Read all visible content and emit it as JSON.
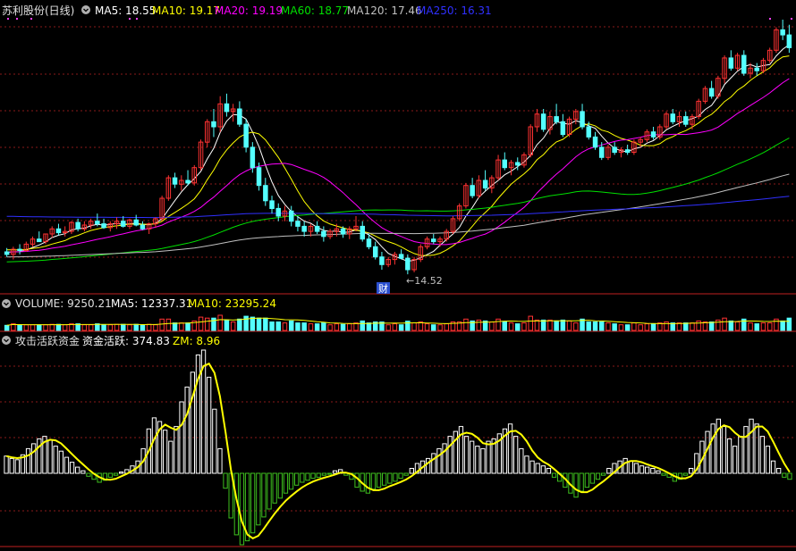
{
  "colors": {
    "background": "#000000",
    "up": "#ff3232",
    "down": "#54ffff",
    "grid": "#8a1a1a",
    "ma5": "#ffffff",
    "ma10": "#ffff00",
    "ma20": "#ff00ff",
    "ma60": "#00e000",
    "ma120": "#c0c0c0",
    "ma250": "#3030ff",
    "volume_ma10": "#ffff00",
    "flow_positive": "#ffffff",
    "flow_negative": "#3ec01e",
    "flow_line": "#ffff00"
  },
  "header": {
    "title": "苏利股份(日线)",
    "dropdown_icon": "circle-chevron-icon",
    "ma5": "MA5: 18.55",
    "ma10": "MA10: 19.17",
    "ma20": "MA20: 19.19",
    "ma60": "MA60: 18.77",
    "ma120": "MA120: 17.46",
    "ma250": "MA250: 16.31"
  },
  "volume_header": {
    "volume": "VOLUME: 9250.21",
    "ma5": "MA5: 12337.31",
    "ma10": "MA10: 23295.24"
  },
  "indicator_header": {
    "name": "攻击活跃资金",
    "active": "资金活跃: 374.83",
    "zm": "ZM: 8.96"
  },
  "annotations": {
    "low_label": "←14.52",
    "finance_badge": "财"
  },
  "chart_data": [
    {
      "type": "candlestick",
      "title": "苏利股份(日线)",
      "price_range": [
        14.0,
        24.5
      ],
      "series_visible_low": 14.52,
      "moving_averages": [
        {
          "name": "MA5",
          "last": 18.55
        },
        {
          "name": "MA10",
          "last": 19.17
        },
        {
          "name": "MA20",
          "last": 19.19
        },
        {
          "name": "MA60",
          "last": 18.77
        },
        {
          "name": "MA120",
          "last": 17.46
        },
        {
          "name": "MA250",
          "last": 16.31
        }
      ],
      "ohlc": [
        [
          15.4,
          15.55,
          15.2,
          15.3
        ],
        [
          15.3,
          15.6,
          15.1,
          15.5
        ],
        [
          15.5,
          15.7,
          15.3,
          15.45
        ],
        [
          15.45,
          15.8,
          15.4,
          15.7
        ],
        [
          15.7,
          16.0,
          15.6,
          15.9
        ],
        [
          15.9,
          16.2,
          15.8,
          15.8
        ],
        [
          15.8,
          16.1,
          15.7,
          16.1
        ],
        [
          16.1,
          16.4,
          15.95,
          16.3
        ],
        [
          16.3,
          16.5,
          16.05,
          16.15
        ],
        [
          16.15,
          16.4,
          16.0,
          16.2
        ],
        [
          16.2,
          16.6,
          16.1,
          16.55
        ],
        [
          16.55,
          16.7,
          16.2,
          16.3
        ],
        [
          16.3,
          16.6,
          16.2,
          16.45
        ],
        [
          16.45,
          16.7,
          16.3,
          16.6
        ],
        [
          16.6,
          16.9,
          16.4,
          16.5
        ],
        [
          16.5,
          16.7,
          16.3,
          16.35
        ],
        [
          16.35,
          16.6,
          16.2,
          16.5
        ],
        [
          16.5,
          16.75,
          16.3,
          16.6
        ],
        [
          16.6,
          16.8,
          16.35,
          16.4
        ],
        [
          16.4,
          16.7,
          16.3,
          16.65
        ],
        [
          16.65,
          16.85,
          16.4,
          16.45
        ],
        [
          16.45,
          16.6,
          16.25,
          16.3
        ],
        [
          16.3,
          16.55,
          16.1,
          16.5
        ],
        [
          16.5,
          16.75,
          16.35,
          16.7
        ],
        [
          16.7,
          17.6,
          16.6,
          17.5
        ],
        [
          17.5,
          18.4,
          17.4,
          18.3
        ],
        [
          18.3,
          18.5,
          17.9,
          18.05
        ],
        [
          18.05,
          18.4,
          17.8,
          18.2
        ],
        [
          18.2,
          18.6,
          18.0,
          18.1
        ],
        [
          18.1,
          18.8,
          18.0,
          18.7
        ],
        [
          18.7,
          19.8,
          18.6,
          19.7
        ],
        [
          19.7,
          20.6,
          19.5,
          20.5
        ],
        [
          20.5,
          21.0,
          19.9,
          20.3
        ],
        [
          20.3,
          21.5,
          20.1,
          21.2
        ],
        [
          21.2,
          21.6,
          20.7,
          20.9
        ],
        [
          20.9,
          21.2,
          20.5,
          21.0
        ],
        [
          21.0,
          21.3,
          20.3,
          20.4
        ],
        [
          20.4,
          20.6,
          19.3,
          19.5
        ],
        [
          19.5,
          19.7,
          18.5,
          18.7
        ],
        [
          18.7,
          18.9,
          17.8,
          18.0
        ],
        [
          18.0,
          18.3,
          17.2,
          17.4
        ],
        [
          17.4,
          17.6,
          16.9,
          17.1
        ],
        [
          17.1,
          17.3,
          16.6,
          16.8
        ],
        [
          16.8,
          17.2,
          16.6,
          17.0
        ],
        [
          17.0,
          17.2,
          16.4,
          16.6
        ],
        [
          16.6,
          16.8,
          16.2,
          16.4
        ],
        [
          16.4,
          16.6,
          16.0,
          16.2
        ],
        [
          16.2,
          16.5,
          16.0,
          16.4
        ],
        [
          16.4,
          16.6,
          16.1,
          16.2
        ],
        [
          16.2,
          16.4,
          15.8,
          16.0
        ],
        [
          16.0,
          16.3,
          15.9,
          16.2
        ],
        [
          16.2,
          16.5,
          16.0,
          16.3
        ],
        [
          16.3,
          16.4,
          15.95,
          16.1
        ],
        [
          16.1,
          16.4,
          15.9,
          16.3
        ],
        [
          16.3,
          16.8,
          16.2,
          16.4
        ],
        [
          16.4,
          16.6,
          15.8,
          15.9
        ],
        [
          15.9,
          16.1,
          15.5,
          15.6
        ],
        [
          15.6,
          15.8,
          15.1,
          15.2
        ],
        [
          15.2,
          15.4,
          14.7,
          14.9
        ],
        [
          14.9,
          15.2,
          14.8,
          15.1
        ],
        [
          15.1,
          15.4,
          14.9,
          15.3
        ],
        [
          15.3,
          15.5,
          15.1,
          15.15
        ],
        [
          15.15,
          15.3,
          14.52,
          14.7
        ],
        [
          14.7,
          15.2,
          14.6,
          15.1
        ],
        [
          15.1,
          15.7,
          15.0,
          15.6
        ],
        [
          15.6,
          16.0,
          15.5,
          15.9
        ],
        [
          15.9,
          16.1,
          15.7,
          15.8
        ],
        [
          15.8,
          16.0,
          15.6,
          15.9
        ],
        [
          15.9,
          16.3,
          15.8,
          16.2
        ],
        [
          16.2,
          16.8,
          16.1,
          16.7
        ],
        [
          16.7,
          17.3,
          16.6,
          17.2
        ],
        [
          17.2,
          18.1,
          17.1,
          18.0
        ],
        [
          18.0,
          18.3,
          17.5,
          17.6
        ],
        [
          17.6,
          18.4,
          17.5,
          18.2
        ],
        [
          18.2,
          18.6,
          17.8,
          17.9
        ],
        [
          17.9,
          18.4,
          17.7,
          18.3
        ],
        [
          18.3,
          19.2,
          18.2,
          19.0
        ],
        [
          19.0,
          19.3,
          18.6,
          18.7
        ],
        [
          18.7,
          19.0,
          18.4,
          18.9
        ],
        [
          18.9,
          19.1,
          18.6,
          18.8
        ],
        [
          18.8,
          19.3,
          18.7,
          19.2
        ],
        [
          19.2,
          20.4,
          19.1,
          20.3
        ],
        [
          20.3,
          21.0,
          20.1,
          20.8
        ],
        [
          20.8,
          21.0,
          20.1,
          20.2
        ],
        [
          20.2,
          20.9,
          20.0,
          20.7
        ],
        [
          20.7,
          21.2,
          20.4,
          20.5
        ],
        [
          20.5,
          20.8,
          19.9,
          20.0
        ],
        [
          20.0,
          20.7,
          19.9,
          20.6
        ],
        [
          20.6,
          21.0,
          20.4,
          20.9
        ],
        [
          20.9,
          21.2,
          20.2,
          20.3
        ],
        [
          20.3,
          20.5,
          19.8,
          19.9
        ],
        [
          19.9,
          20.1,
          19.4,
          19.5
        ],
        [
          19.5,
          19.7,
          19.0,
          19.1
        ],
        [
          19.1,
          19.6,
          19.0,
          19.5
        ],
        [
          19.5,
          19.7,
          19.2,
          19.3
        ],
        [
          19.3,
          19.5,
          19.1,
          19.4
        ],
        [
          19.4,
          19.6,
          19.2,
          19.3
        ],
        [
          19.3,
          19.8,
          19.2,
          19.7
        ],
        [
          19.7,
          19.9,
          19.5,
          19.8
        ],
        [
          19.8,
          20.2,
          19.7,
          20.1
        ],
        [
          20.1,
          20.3,
          19.8,
          19.9
        ],
        [
          19.9,
          20.4,
          19.8,
          20.3
        ],
        [
          20.3,
          20.9,
          20.2,
          20.8
        ],
        [
          20.8,
          21.0,
          20.4,
          20.5
        ],
        [
          20.5,
          20.9,
          20.3,
          20.7
        ],
        [
          20.7,
          20.9,
          20.3,
          20.4
        ],
        [
          20.4,
          20.8,
          20.2,
          20.7
        ],
        [
          20.7,
          21.4,
          20.6,
          21.3
        ],
        [
          21.3,
          21.9,
          21.2,
          21.8
        ],
        [
          21.8,
          22.1,
          21.4,
          21.5
        ],
        [
          21.5,
          22.3,
          21.4,
          22.2
        ],
        [
          22.2,
          23.1,
          22.0,
          23.0
        ],
        [
          23.0,
          23.3,
          22.5,
          22.6
        ],
        [
          22.6,
          23.2,
          22.5,
          23.1
        ],
        [
          23.1,
          23.3,
          22.3,
          22.4
        ],
        [
          22.4,
          22.8,
          22.2,
          22.6
        ],
        [
          22.6,
          22.8,
          22.3,
          22.5
        ],
        [
          22.5,
          23.0,
          22.4,
          22.9
        ],
        [
          22.9,
          23.4,
          22.8,
          23.3
        ],
        [
          23.3,
          24.2,
          23.2,
          24.1
        ],
        [
          24.1,
          24.5,
          23.7,
          23.9
        ],
        [
          23.9,
          24.3,
          23.2,
          23.4
        ]
      ]
    },
    {
      "type": "bar",
      "title": "VOLUME",
      "series": [
        {
          "name": "VOLUME",
          "last": 9250.21
        },
        {
          "name": "MA5",
          "last": 12337.31
        },
        {
          "name": "MA10",
          "last": 23295.24
        }
      ]
    },
    {
      "type": "bar",
      "title": "攻击活跃资金",
      "series": [
        {
          "name": "资金活跃",
          "last": 374.83
        },
        {
          "name": "ZM",
          "last": 8.96
        }
      ],
      "values": [
        14,
        12,
        11,
        15,
        20,
        24,
        28,
        30,
        27,
        22,
        18,
        13,
        9,
        5,
        2,
        -3,
        -6,
        -9,
        -7,
        -4,
        -2,
        1,
        3,
        6,
        10,
        20,
        36,
        45,
        42,
        35,
        26,
        38,
        58,
        70,
        82,
        96,
        100,
        78,
        52,
        20,
        -15,
        -45,
        -62,
        -72,
        -68,
        -60,
        -52,
        -44,
        -36,
        -30,
        -25,
        -20,
        -16,
        -12,
        -9,
        -7,
        -5,
        -4,
        -2,
        -1,
        2,
        3,
        -2,
        -6,
        -14,
        -18,
        -20,
        -16,
        -14,
        -12,
        -10,
        -8,
        -5,
        -2,
        4,
        8,
        10,
        12,
        16,
        20,
        24,
        30,
        34,
        38,
        30,
        26,
        22,
        20,
        26,
        28,
        32,
        36,
        40,
        30,
        20,
        14,
        10,
        8,
        6,
        4,
        -4,
        -8,
        -14,
        -20,
        -24,
        -18,
        -14,
        -10,
        -6,
        -2,
        4,
        8,
        10,
        12,
        10,
        8,
        6,
        5,
        4,
        2,
        -2,
        -4,
        -8,
        -6,
        -2,
        4,
        16,
        26,
        34,
        40,
        44,
        38,
        28,
        22,
        30,
        38,
        44,
        40,
        30,
        22,
        10,
        4,
        -4,
        -6
      ],
      "zero_line": 0
    }
  ]
}
